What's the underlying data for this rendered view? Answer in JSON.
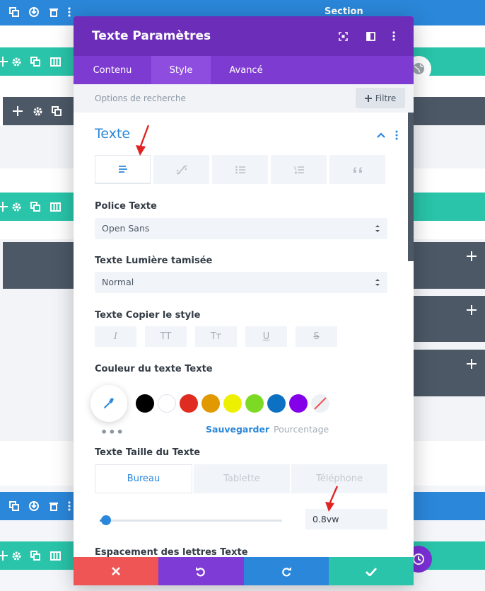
{
  "builder": {
    "section_label": "Section"
  },
  "modal": {
    "title": "Texte Paramètres",
    "tabs": [
      {
        "label": "Contenu",
        "active": false
      },
      {
        "label": "Style",
        "active": true
      },
      {
        "label": "Avancé",
        "active": false
      }
    ],
    "search": {
      "placeholder": "Options de recherche",
      "filter_label": "Filtre"
    },
    "group_title": "Texte",
    "alignment": {
      "options": [
        "text-left-icon",
        "link-icon",
        "unordered-list-icon",
        "ordered-list-icon",
        "quote-icon"
      ],
      "selected": "text-left-icon"
    },
    "font": {
      "label": "Police Texte",
      "value": "Open Sans"
    },
    "weight": {
      "label": "Texte Lumière tamisée",
      "value": "Normal"
    },
    "style": {
      "label": "Texte Copier le style",
      "buttons": [
        "I",
        "TT",
        "Tт",
        "U",
        "S"
      ]
    },
    "color": {
      "label": "Couleur du texte Texte",
      "swatches": [
        "#000000",
        "#ffffff",
        "#e02b20",
        "#e09900",
        "#edf000",
        "#7cda24",
        "#0c71c3",
        "#8300e9"
      ],
      "dots": "•••",
      "save": "Sauvegarder",
      "percent": "Pourcentage"
    },
    "size": {
      "label": "Texte Taille du Texte",
      "devices": [
        {
          "label": "Bureau",
          "active": true
        },
        {
          "label": "Tablette",
          "active": false
        },
        {
          "label": "Téléphone",
          "active": false
        }
      ],
      "value": "0.8vw",
      "slider_fraction": 0.02
    },
    "spacing_label": "Espacement des lettres Texte",
    "footer": {
      "colors": [
        "#ef5555",
        "#7f3bd6",
        "#2b87da",
        "#29c4a9"
      ],
      "icons": [
        "close-icon",
        "undo-icon",
        "redo-icon",
        "check-icon"
      ]
    }
  }
}
